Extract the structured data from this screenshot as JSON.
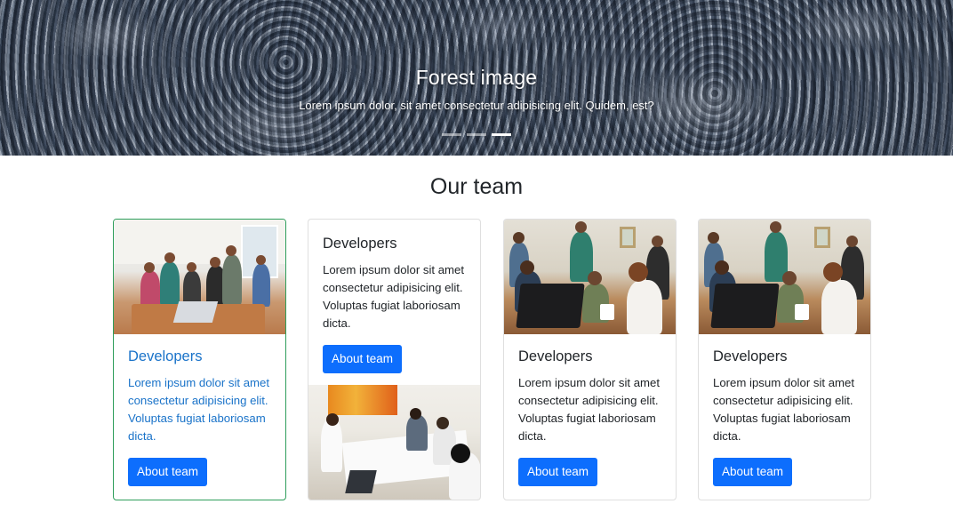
{
  "hero": {
    "title": "Forest image",
    "text": "Lorem ipsum dolor, sit amet consectetur adipisicing elit. Quidem, est?",
    "indicators": [
      "slide-1",
      "slide-2",
      "slide-3"
    ],
    "active_indicator": 3
  },
  "section": {
    "title": "Our team"
  },
  "cards": [
    {
      "title": "Developers",
      "text": "Lorem ipsum dolor sit amet consectetur adipisicing elit. Voluptas fugiat laboriosam dicta.",
      "button": "About team",
      "image": "office-team-photo"
    },
    {
      "title": "Developers",
      "text": "Lorem ipsum dolor sit amet consectetur adipisicing elit. Voluptas fugiat laboriosam dicta.",
      "button": "About team",
      "image": "meeting-photo"
    },
    {
      "title": "Developers",
      "text": "Lorem ipsum dolor sit amet consectetur adipisicing elit. Voluptas fugiat laboriosam dicta.",
      "button": "About team",
      "image": "team-laptop-photo"
    },
    {
      "title": "Developers",
      "text": "Lorem ipsum dolor sit amet consectetur adipisicing elit. Voluptas fugiat laboriosam dicta.",
      "button": "About team",
      "image": "team-laptop-photo"
    }
  ],
  "colors": {
    "primary": "#0d6efd",
    "highlight_border": "#2e9e5b",
    "highlight_text": "#1a73c9"
  }
}
